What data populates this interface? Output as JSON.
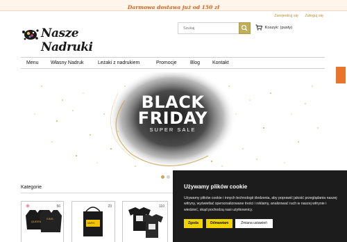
{
  "promo": {
    "text": "Darmowa dostawa już od 150 zł"
  },
  "account": {
    "register": "Zarejestruj się",
    "login": "Zaloguj się"
  },
  "logo": {
    "text": "Nasze Nadruki"
  },
  "search": {
    "placeholder": "Szukaj"
  },
  "cart": {
    "label": "Koszyk:",
    "status": "(pusty)"
  },
  "nav": {
    "items": [
      {
        "label": "Menu"
      },
      {
        "label": "Własny Nadruk"
      },
      {
        "label": "Leżaki z nadrukiem"
      },
      {
        "label": "Promocje"
      },
      {
        "label": "Blog"
      },
      {
        "label": "Kontakt"
      }
    ]
  },
  "banner": {
    "line1": "BLACK",
    "line2": "FRIDAY",
    "line3": "SUPER SALE"
  },
  "slider": {
    "active_index": 0,
    "total": 2
  },
  "categories": {
    "title": "Kategorie",
    "items": [
      {
        "count": "56"
      },
      {
        "count": "23"
      },
      {
        "count": "110"
      }
    ]
  },
  "cookie": {
    "title": "Używamy plików cookie",
    "body": "Używamy plików cookie i innych technologii śledzenia, aby poprawić jakość przeglądania naszej witryny, wyświetlać spersonalizowane treści i reklamy, analizować ruch w naszej witrynie i wiedzieć, skąd pochodzą nasi użytkownicy.",
    "accept": "Zgoda",
    "reject": "Odmawiam",
    "settings": "Zmiana ustawień"
  },
  "colors": {
    "accent": "#d9621f",
    "gold": "#c2ad59",
    "cookie_bg": "#1c1c1c",
    "cookie_button": "#f2d400"
  }
}
